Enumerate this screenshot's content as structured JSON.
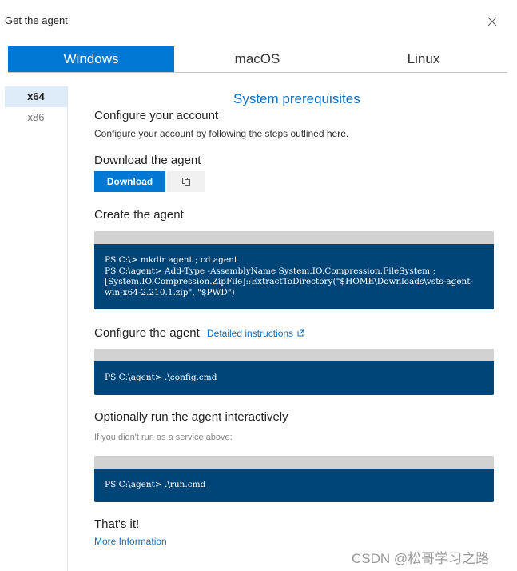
{
  "dialog": {
    "title": "Get the agent",
    "close_icon": "close-icon"
  },
  "tabs": [
    {
      "label": "Windows",
      "active": true
    },
    {
      "label": "macOS",
      "active": false
    },
    {
      "label": "Linux",
      "active": false
    }
  ],
  "sidebar": {
    "items": [
      {
        "label": "x64",
        "active": true
      },
      {
        "label": "x86",
        "active": false
      }
    ]
  },
  "main": {
    "prerequisites_link": "System prerequisites",
    "configure_account": {
      "heading": "Configure your account",
      "text": "Configure your account by following the steps outlined ",
      "link": "here",
      "suffix": "."
    },
    "download": {
      "heading": "Download the agent",
      "button": "Download",
      "copy_icon": "copy-icon"
    },
    "create": {
      "heading": "Create the agent",
      "code": "PS C:\\> mkdir agent ; cd agent\nPS C:\\agent> Add-Type -AssemblyName System.IO.Compression.FileSystem ;\n[System.IO.Compression.ZipFile]::ExtractToDirectory(\"$HOME\\Downloads\\vsts-agent-win-x64-2.210.1.zip\", \"$PWD\")"
    },
    "configure": {
      "heading": "Configure the agent",
      "link": "Detailed instructions",
      "link_icon": "external-link-icon",
      "code": "PS C:\\agent> .\\config.cmd"
    },
    "optional": {
      "heading": "Optionally run the agent interactively",
      "note": "If you didn't run as a service above:",
      "code": "PS C:\\agent> .\\run.cmd"
    },
    "done": {
      "heading": "That's it!",
      "link": "More Information"
    }
  },
  "watermark": "CSDN @松哥学习之路",
  "colors": {
    "accent": "#0078d4",
    "code_bg": "#004578",
    "link": "#106ebe"
  }
}
